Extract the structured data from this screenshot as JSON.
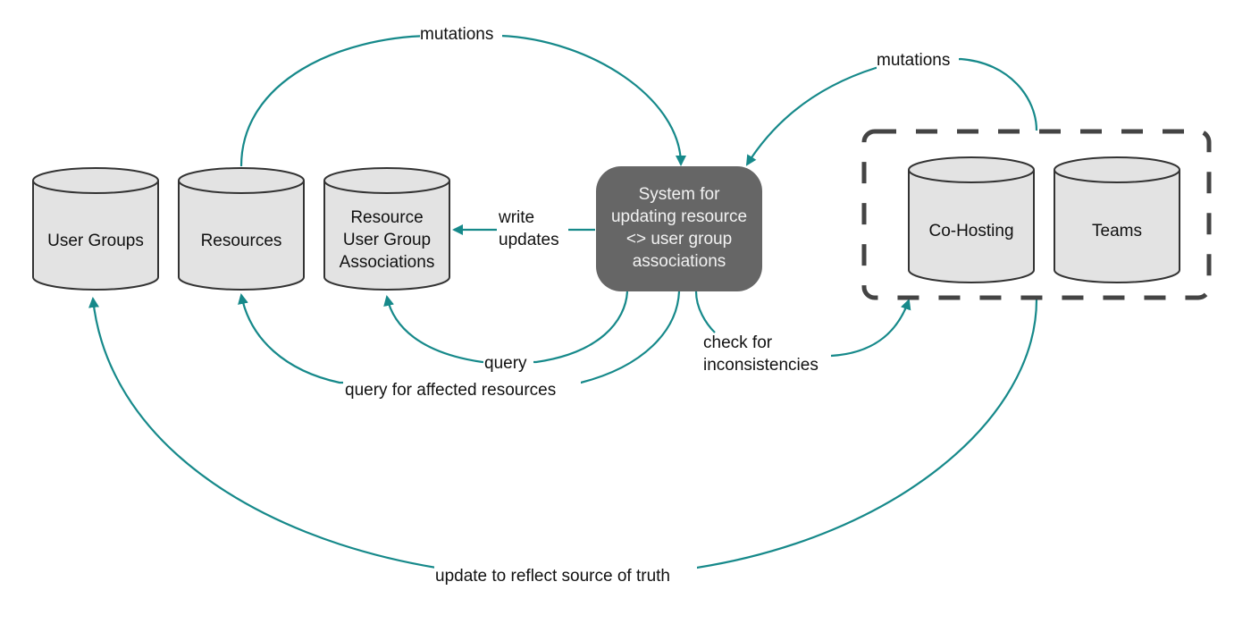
{
  "colors": {
    "edge": "#16898a",
    "cylinder_fill": "#e3e3e3",
    "cylinder_stroke": "#333333",
    "system_fill": "#666666",
    "system_text": "#f2f2f2",
    "group_border": "#444444"
  },
  "nodes": {
    "user_groups": {
      "label": [
        "User Groups"
      ]
    },
    "resources": {
      "label": [
        "Resources"
      ]
    },
    "associations": {
      "label": [
        "Resource",
        "User Group",
        "Associations"
      ]
    },
    "system": {
      "label": [
        "System for",
        "updating resource",
        "<> user group",
        "associations"
      ]
    },
    "co_hosting": {
      "label": [
        "Co-Hosting"
      ]
    },
    "teams": {
      "label": [
        "Teams"
      ]
    }
  },
  "edges": {
    "mutations_resources": {
      "label": [
        "mutations"
      ]
    },
    "mutations_group": {
      "label": [
        "mutations"
      ]
    },
    "write_updates": {
      "label": [
        "write",
        "updates"
      ]
    },
    "query": {
      "label": [
        "query"
      ]
    },
    "query_affected": {
      "label": [
        "query for affected resources"
      ]
    },
    "check_inconsistencies": {
      "label": [
        "check for",
        "inconsistencies"
      ]
    },
    "update_source_of_truth": {
      "label": [
        "update to reflect source of truth"
      ]
    }
  }
}
